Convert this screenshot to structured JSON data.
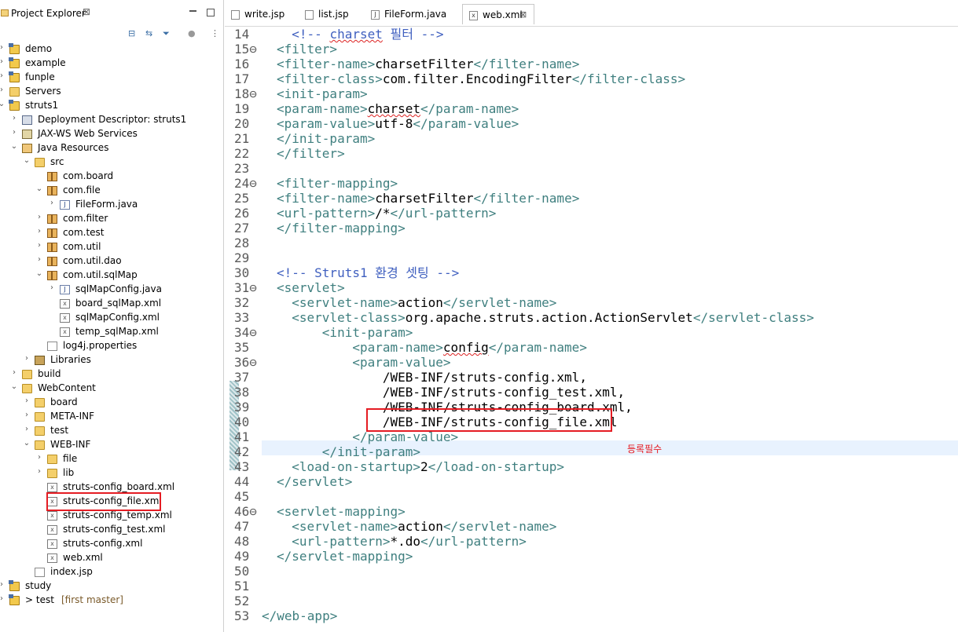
{
  "explorer": {
    "title": "Project Explorer",
    "close_glyph": "⊠",
    "items": [
      {
        "label": "demo",
        "icon": "project-icon",
        "depth": 0,
        "toggle": ">"
      },
      {
        "label": "example",
        "icon": "project-icon",
        "depth": 0,
        "toggle": ">"
      },
      {
        "label": "funple",
        "icon": "project-icon",
        "depth": 0,
        "toggle": ">"
      },
      {
        "label": "Servers",
        "icon": "folder-icon",
        "depth": 0,
        "toggle": ">"
      },
      {
        "label": "struts1",
        "icon": "project-icon",
        "depth": 0,
        "toggle": "v"
      },
      {
        "label": "Deployment Descriptor: struts1",
        "icon": "descriptor-icon",
        "depth": 1,
        "toggle": ">"
      },
      {
        "label": "JAX-WS Web Services",
        "icon": "webservice-icon",
        "depth": 1,
        "toggle": ">"
      },
      {
        "label": "Java Resources",
        "icon": "java-resources-icon",
        "depth": 1,
        "toggle": "v"
      },
      {
        "label": "src",
        "icon": "source-folder-icon",
        "depth": 2,
        "toggle": "v"
      },
      {
        "label": "com.board",
        "icon": "package-icon",
        "depth": 3,
        "toggle": ""
      },
      {
        "label": "com.file",
        "icon": "package-icon",
        "depth": 3,
        "toggle": "v"
      },
      {
        "label": "FileForm.java",
        "icon": "java-file-icon",
        "depth": 4,
        "toggle": ">"
      },
      {
        "label": "com.filter",
        "icon": "package-icon",
        "depth": 3,
        "toggle": ">"
      },
      {
        "label": "com.test",
        "icon": "package-icon",
        "depth": 3,
        "toggle": ">"
      },
      {
        "label": "com.util",
        "icon": "package-icon",
        "depth": 3,
        "toggle": ">"
      },
      {
        "label": "com.util.dao",
        "icon": "package-icon",
        "depth": 3,
        "toggle": ">"
      },
      {
        "label": "com.util.sqlMap",
        "icon": "package-icon",
        "depth": 3,
        "toggle": "v"
      },
      {
        "label": "sqlMapConfig.java",
        "icon": "java-file-icon",
        "depth": 4,
        "toggle": ">"
      },
      {
        "label": "board_sqlMap.xml",
        "icon": "xml-file-icon",
        "depth": 4,
        "toggle": ""
      },
      {
        "label": "sqlMapConfig.xml",
        "icon": "xml-file-icon",
        "depth": 4,
        "toggle": ""
      },
      {
        "label": "temp_sqlMap.xml",
        "icon": "xml-file-icon",
        "depth": 4,
        "toggle": ""
      },
      {
        "label": "log4j.properties",
        "icon": "file-icon",
        "depth": 3,
        "toggle": ""
      },
      {
        "label": "Libraries",
        "icon": "library-icon",
        "depth": 2,
        "toggle": ">"
      },
      {
        "label": "build",
        "icon": "folder-icon",
        "depth": 1,
        "toggle": ">"
      },
      {
        "label": "WebContent",
        "icon": "folder-icon",
        "depth": 1,
        "toggle": "v"
      },
      {
        "label": "board",
        "icon": "folder-icon",
        "depth": 2,
        "toggle": ">"
      },
      {
        "label": "META-INF",
        "icon": "folder-icon",
        "depth": 2,
        "toggle": ">"
      },
      {
        "label": "test",
        "icon": "folder-icon",
        "depth": 2,
        "toggle": ">"
      },
      {
        "label": "WEB-INF",
        "icon": "folder-icon",
        "depth": 2,
        "toggle": "v"
      },
      {
        "label": "file",
        "icon": "folder-icon",
        "depth": 3,
        "toggle": ">"
      },
      {
        "label": "lib",
        "icon": "folder-icon",
        "depth": 3,
        "toggle": ">"
      },
      {
        "label": "struts-config_board.xml",
        "icon": "xml-file-icon",
        "depth": 3,
        "toggle": ""
      },
      {
        "label": "struts-config_file.xml",
        "icon": "xml-file-icon",
        "depth": 3,
        "toggle": "",
        "highlight": true
      },
      {
        "label": "struts-config_temp.xml",
        "icon": "xml-file-icon",
        "depth": 3,
        "toggle": ""
      },
      {
        "label": "struts-config_test.xml",
        "icon": "xml-file-icon",
        "depth": 3,
        "toggle": ""
      },
      {
        "label": "struts-config.xml",
        "icon": "xml-file-icon",
        "depth": 3,
        "toggle": ""
      },
      {
        "label": "web.xml",
        "icon": "xml-file-icon",
        "depth": 3,
        "toggle": ""
      },
      {
        "label": "index.jsp",
        "icon": "file-icon",
        "depth": 2,
        "toggle": ""
      },
      {
        "label": "study",
        "icon": "project-icon",
        "depth": 0,
        "toggle": ">"
      },
      {
        "label": "> test",
        "git": "[first master]",
        "icon": "project-icon",
        "depth": 0,
        "toggle": ">"
      }
    ]
  },
  "tabs": [
    {
      "label": "write.jsp",
      "icon": "jsp-file-icon",
      "active": false
    },
    {
      "label": "list.jsp",
      "icon": "jsp-file-icon",
      "active": false
    },
    {
      "label": "FileForm.java",
      "icon": "java-file-icon",
      "active": false
    },
    {
      "label": "web.xml",
      "icon": "xml-file-icon",
      "active": true,
      "close": "⊠"
    }
  ],
  "editor": {
    "lines": [
      {
        "n": "14",
        "fold": "",
        "parts": [
          [
            "cmt",
            "  <!-- "
          ],
          [
            "cmt sq",
            "charset"
          ],
          [
            "cmt",
            " 필터 -->"
          ]
        ]
      },
      {
        "n": "15",
        "fold": "⊖",
        "parts": [
          [
            "tag",
            "<filter>"
          ]
        ]
      },
      {
        "n": "16",
        "fold": "",
        "parts": [
          [
            "tag",
            "<filter-name>"
          ],
          [
            "txt",
            "charsetFilter"
          ],
          [
            "tag",
            "</filter-name>"
          ]
        ]
      },
      {
        "n": "17",
        "fold": "",
        "parts": [
          [
            "tag",
            "<filter-class>"
          ],
          [
            "txt",
            "com.filter.EncodingFilter"
          ],
          [
            "tag",
            "</filter-class>"
          ]
        ]
      },
      {
        "n": "18",
        "fold": "⊖",
        "parts": [
          [
            "tag",
            "<init-param>"
          ]
        ]
      },
      {
        "n": "19",
        "fold": "",
        "parts": [
          [
            "tag",
            "<param-name>"
          ],
          [
            "txt sq",
            "charset"
          ],
          [
            "tag",
            "</param-name>"
          ]
        ]
      },
      {
        "n": "20",
        "fold": "",
        "parts": [
          [
            "tag",
            "<param-value>"
          ],
          [
            "txt",
            "utf-8"
          ],
          [
            "tag",
            "</param-value>"
          ]
        ]
      },
      {
        "n": "21",
        "fold": "",
        "parts": [
          [
            "tag",
            "</init-param>"
          ]
        ]
      },
      {
        "n": "22",
        "fold": "",
        "parts": [
          [
            "tag",
            "</filter>"
          ]
        ]
      },
      {
        "n": "23",
        "fold": "",
        "parts": []
      },
      {
        "n": "24",
        "fold": "⊖",
        "parts": [
          [
            "tag",
            "<filter-mapping>"
          ]
        ]
      },
      {
        "n": "25",
        "fold": "",
        "parts": [
          [
            "tag",
            "<filter-name>"
          ],
          [
            "txt",
            "charsetFilter"
          ],
          [
            "tag",
            "</filter-name>"
          ]
        ]
      },
      {
        "n": "26",
        "fold": "",
        "parts": [
          [
            "tag",
            "<url-pattern>"
          ],
          [
            "txt",
            "/*"
          ],
          [
            "tag",
            "</url-pattern>"
          ]
        ]
      },
      {
        "n": "27",
        "fold": "",
        "parts": [
          [
            "tag",
            "</filter-mapping>"
          ]
        ]
      },
      {
        "n": "28",
        "fold": "",
        "parts": []
      },
      {
        "n": "29",
        "fold": "",
        "parts": []
      },
      {
        "n": "30",
        "fold": "",
        "parts": [
          [
            "cmt",
            "<!-- Struts1 환경 셋팅 -->"
          ]
        ]
      },
      {
        "n": "31",
        "fold": "⊖",
        "parts": [
          [
            "tag",
            "<servlet>"
          ]
        ]
      },
      {
        "n": "32",
        "fold": "",
        "parts": [
          [
            "tag",
            "  <servlet-name>"
          ],
          [
            "txt",
            "action"
          ],
          [
            "tag",
            "</servlet-name>"
          ]
        ]
      },
      {
        "n": "33",
        "fold": "",
        "parts": [
          [
            "tag",
            "  <servlet-class>"
          ],
          [
            "txt",
            "org.apache.struts.action.ActionServlet"
          ],
          [
            "tag",
            "</servlet-class>"
          ]
        ]
      },
      {
        "n": "34",
        "fold": "⊖",
        "parts": [
          [
            "tag",
            "      <init-param>"
          ]
        ]
      },
      {
        "n": "35",
        "fold": "",
        "parts": [
          [
            "tag",
            "          <param-name>"
          ],
          [
            "txt sq",
            "config"
          ],
          [
            "tag",
            "</param-name>"
          ]
        ]
      },
      {
        "n": "36",
        "fold": "⊖",
        "parts": [
          [
            "tag",
            "          <param-value>"
          ]
        ]
      },
      {
        "n": "37",
        "fold": "",
        "parts": [
          [
            "txt",
            "              /WEB-INF/struts-config.xml,"
          ]
        ]
      },
      {
        "n": "38",
        "fold": "",
        "parts": [
          [
            "txt",
            "              /WEB-INF/struts-config_test.xml,"
          ]
        ]
      },
      {
        "n": "39",
        "fold": "",
        "parts": [
          [
            "txt",
            "              /WEB-INF/struts-config_board.xml,"
          ]
        ]
      },
      {
        "n": "40",
        "fold": "",
        "parts": [
          [
            "txt",
            "              /WEB-INF/struts-config_file.xml"
          ]
        ]
      },
      {
        "n": "41",
        "fold": "",
        "parts": [
          [
            "tag",
            "          </param-value>"
          ]
        ]
      },
      {
        "n": "42",
        "fold": "",
        "parts": [
          [
            "tag",
            "      </init-param>"
          ]
        ]
      },
      {
        "n": "43",
        "fold": "",
        "parts": [
          [
            "tag",
            "  <load-on-startup>"
          ],
          [
            "txt",
            "2"
          ],
          [
            "tag",
            "</load-on-startup>"
          ]
        ]
      },
      {
        "n": "44",
        "fold": "",
        "parts": [
          [
            "tag",
            "</servlet>"
          ]
        ]
      },
      {
        "n": "45",
        "fold": "",
        "parts": []
      },
      {
        "n": "46",
        "fold": "⊖",
        "parts": [
          [
            "tag",
            "<servlet-mapping>"
          ]
        ]
      },
      {
        "n": "47",
        "fold": "",
        "parts": [
          [
            "tag",
            "  <servlet-name>"
          ],
          [
            "txt",
            "action"
          ],
          [
            "tag",
            "</servlet-name>"
          ]
        ]
      },
      {
        "n": "48",
        "fold": "",
        "parts": [
          [
            "tag",
            "  <url-pattern>"
          ],
          [
            "txt",
            "*.do"
          ],
          [
            "tag",
            "</url-pattern>"
          ]
        ]
      },
      {
        "n": "49",
        "fold": "",
        "parts": [
          [
            "tag",
            "</servlet-mapping>"
          ]
        ]
      },
      {
        "n": "50",
        "fold": "",
        "parts": []
      },
      {
        "n": "51",
        "fold": "",
        "parts": []
      },
      {
        "n": "52",
        "fold": "",
        "parts": []
      },
      {
        "n": "53",
        "fold": "",
        "parts": [
          [
            "tag",
            "</web-app>"
          ]
        ]
      }
    ],
    "annotation": "등록필수"
  },
  "colors": {
    "tag": "#3f7f7f",
    "comment": "#3f5fbf",
    "highlight": "#e51c23",
    "current_line": "#e8f2fe"
  }
}
